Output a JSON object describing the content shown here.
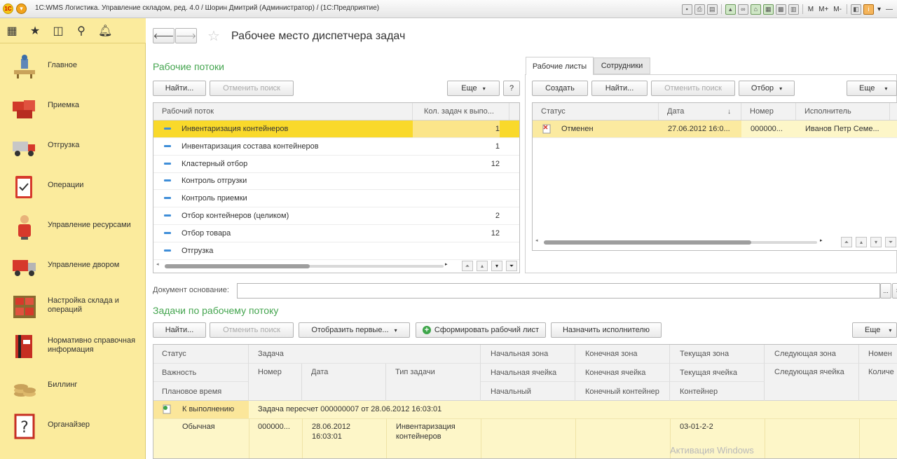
{
  "window": {
    "title": "1С:WMS Логистика. Управление складом, ред. 4.0 / Шорин Дмитрий (Администратор) /  (1С:Предприятие)",
    "tools": [
      "M",
      "M+",
      "M-"
    ]
  },
  "sections": [
    {
      "label": "Главное",
      "icon": "home-desk-icon"
    },
    {
      "label": "Приемка",
      "icon": "receiving-boxes-icon"
    },
    {
      "label": "Отгрузка",
      "icon": "shipping-truck-icon"
    },
    {
      "label": "Операции",
      "icon": "clipboard-icon"
    },
    {
      "label": "Управление ресурсами",
      "icon": "worker-icon"
    },
    {
      "label": "Управление двором",
      "icon": "yard-truck-icon"
    },
    {
      "label": "Настройка склада и операций",
      "icon": "warehouse-shelf-icon"
    },
    {
      "label": "Нормативно справочная информация",
      "icon": "binder-icon"
    },
    {
      "label": "Биллинг",
      "icon": "coins-icon"
    },
    {
      "label": "Органайзер",
      "icon": "organizer-question-icon"
    }
  ],
  "page": {
    "title": "Рабочее место диспетчера задач"
  },
  "flows": {
    "title": "Рабочие потоки",
    "find_label": "Найти...",
    "cancel_search_label": "Отменить поиск",
    "more_label": "Еще",
    "help_label": "?",
    "columns": [
      "Рабочий поток",
      "Кол. задач к выпо..."
    ],
    "rows": [
      {
        "name": "Инвентаризация контейнеров",
        "count": "1"
      },
      {
        "name": "Инвентаризация состава контейнеров",
        "count": "1"
      },
      {
        "name": "Кластерный отбор",
        "count": "12"
      },
      {
        "name": "Контроль отгрузки",
        "count": ""
      },
      {
        "name": "Контроль приемки",
        "count": ""
      },
      {
        "name": "Отбор контейнеров (целиком)",
        "count": "2"
      },
      {
        "name": "Отбор товара",
        "count": "12"
      },
      {
        "name": "Отгрузка",
        "count": ""
      }
    ],
    "scroll_fraction": 0.52
  },
  "sheets": {
    "tabs": [
      "Рабочие листы",
      "Сотрудники"
    ],
    "active_tab": 0,
    "create_label": "Создать",
    "find_label": "Найти...",
    "cancel_search_label": "Отменить поиск",
    "filter_label": "Отбор",
    "more_label": "Еще",
    "columns": [
      "Статус",
      "Дата",
      "Номер",
      "Исполнитель"
    ],
    "rows": [
      {
        "status": "Отменен",
        "date": "27.06.2012 16:0...",
        "number": "000000...",
        "executor": "Иванов Петр Семе..."
      }
    ],
    "scroll_fraction": 0.76
  },
  "document": {
    "label": "Документ основание:",
    "value": "",
    "pick_label": "...",
    "clear_label": "×"
  },
  "tasks": {
    "title": "Задачи по рабочему потоку",
    "find_label": "Найти...",
    "cancel_search_label": "Отменить поиск",
    "show_first_label": "Отобразить первые...",
    "form_sheet_label": "Сформировать рабочий лист",
    "assign_label": "Назначить исполнителю",
    "more_label": "Еще",
    "header": {
      "c1": [
        "Статус",
        "Важность",
        "Плановое время"
      ],
      "task": "Задача",
      "number": "Номер",
      "date": "Дата",
      "type": "Тип задачи",
      "start": [
        "Начальная зона",
        "Начальная ячейка",
        "Начальный"
      ],
      "end": [
        "Конечная зона",
        "Конечная ячейка",
        "Конечный контейнер"
      ],
      "current": [
        "Текущая зона",
        "Текущая ячейка",
        "Контейнер"
      ],
      "next": [
        "Следующая зона",
        "Следующая ячейка"
      ],
      "extra": [
        "Номен",
        "Количе"
      ]
    },
    "row": {
      "status": "К выполнению",
      "description": "Задача пересчет 000000007 от 28.06.2012 16:03:01",
      "importance": "Обычная",
      "number": "000000...",
      "date_line1": "28.06.2012",
      "date_line2": "16:03:01",
      "type_line1": "Инвентаризация",
      "type_line2": "контейнеров",
      "current_cell": "03-01-2-2"
    }
  },
  "watermark": "Активация Windows",
  "colors": {
    "section_panel": "#fbeb9d",
    "selected_row": "#f9d92b",
    "accent_green": "#44a54f",
    "light_row": "#fdf6c8"
  }
}
